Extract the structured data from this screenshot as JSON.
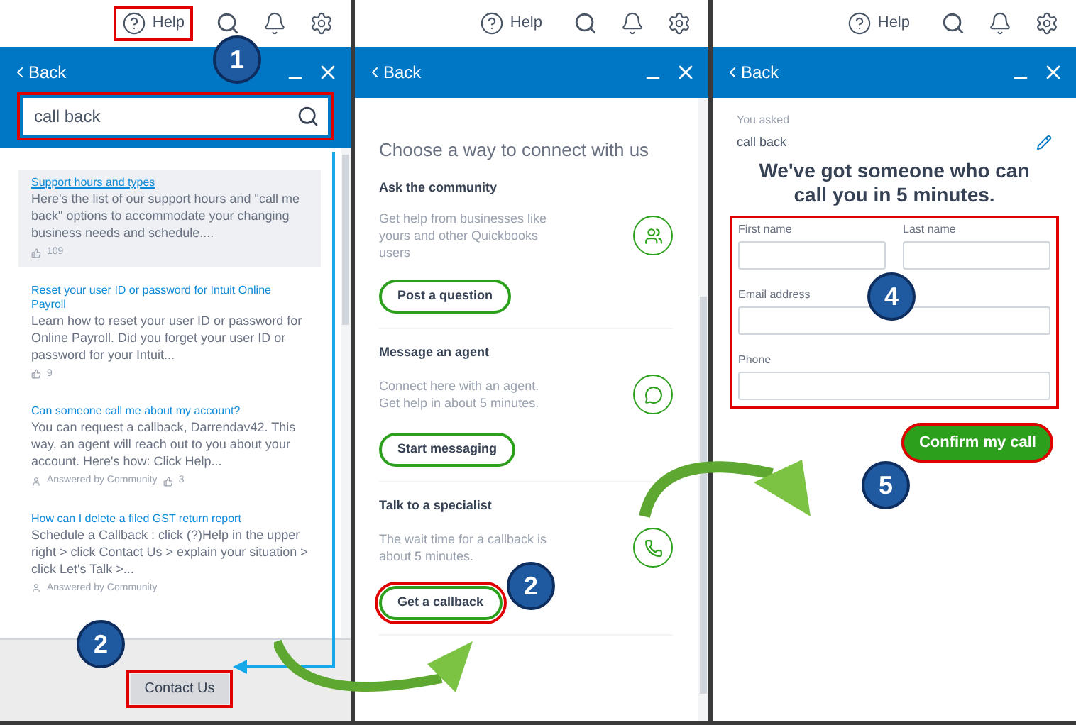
{
  "top_bars": [
    {
      "help": "Help",
      "highlighted": true
    },
    {
      "help": "Help",
      "highlighted": false
    },
    {
      "help": "Help",
      "highlighted": false
    }
  ],
  "search_panel": {
    "back": "Back",
    "search": {
      "value": "call back"
    },
    "results": [
      {
        "title": "Support hours and types",
        "snippet": "Here's the list of our support hours and \"call me back\" options to accommodate your changing business needs and schedule....",
        "likes": "109",
        "selected": true
      },
      {
        "title": "Reset your user ID or password for Intuit Online Payroll",
        "snippet": "Learn how to reset your user ID or password for Online Payroll. Did you forget your user ID or password for your Intuit...",
        "likes": "9",
        "selected": false
      },
      {
        "title": "Can someone call me about my account?",
        "snippet": "You can request a callback, Darrendav42. This way, an agent will reach out to you about your account. Here's how: Click Help...",
        "answered": "Answered by Community",
        "likes": "3",
        "selected": false
      },
      {
        "title": "How can I delete a filed GST return report",
        "snippet": "Schedule a Callback : click (?)Help in the upper right > click Contact Us > explain your situation > click Let's Talk >...",
        "answered": "Answered by Community",
        "selected": false
      }
    ],
    "contact_button": "Contact Us"
  },
  "contact_panel": {
    "back": "Back",
    "heading": "Choose a way to connect with us",
    "options": [
      {
        "kind": "community",
        "title": "Ask the community",
        "text": "Get help from businesses like yours and other Quickbooks users",
        "button": "Post a question",
        "highlighted": false
      },
      {
        "kind": "message",
        "title": "Message an agent",
        "text": "Connect here with an agent. Get help in about 5 minutes.",
        "button": "Start messaging",
        "highlighted": false
      },
      {
        "kind": "phone",
        "title": "Talk to a specialist",
        "text": "The wait time for a callback is about 5 minutes.",
        "button": "Get a callback",
        "highlighted": true
      }
    ]
  },
  "callback_panel": {
    "back": "Back",
    "asked_label": "You asked",
    "asked_value": "call back",
    "heading": "We've got someone who can call you in 5 minutes.",
    "fields": [
      {
        "label": "First name"
      },
      {
        "label": "Last name"
      },
      {
        "label": "Email address"
      },
      {
        "label": "Phone"
      }
    ],
    "confirm_button": "Confirm my call"
  },
  "steps": [
    "1",
    "2",
    "2",
    "4",
    "5"
  ]
}
